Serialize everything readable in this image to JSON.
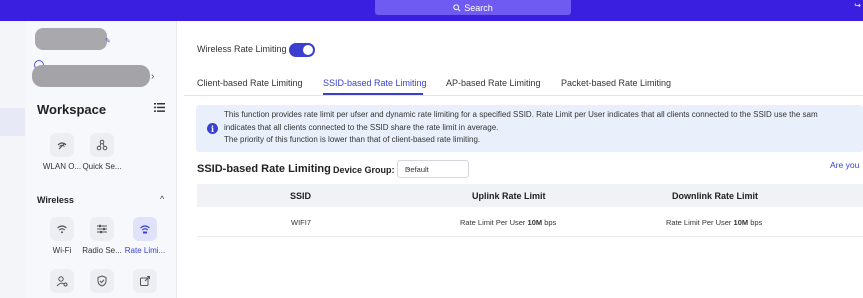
{
  "topbar": {
    "search_label": "Search"
  },
  "sidebar": {
    "workspace_title": "Workspace",
    "workspace_tiles": [
      {
        "label": "WLAN O...",
        "icon": "wlan-icon"
      },
      {
        "label": "Quick Se...",
        "icon": "quick-setup-icon"
      }
    ],
    "section_title": "Wireless",
    "wireless_tiles": [
      {
        "label": "Wi-Fi",
        "icon": "wifi-icon"
      },
      {
        "label": "Radio Se...",
        "icon": "radio-settings-icon"
      },
      {
        "label": "Rate Limi...",
        "icon": "rate-limit-icon",
        "active": true
      }
    ]
  },
  "main": {
    "toggle_label": "Wireless Rate Limiting",
    "toggle_on": true,
    "tabs": [
      {
        "label": "Client-based Rate Limiting"
      },
      {
        "label": "SSID-based Rate Limiting",
        "active": true
      },
      {
        "label": "AP-based Rate Limiting"
      },
      {
        "label": "Packet-based Rate Limiting"
      }
    ],
    "info_lines": [
      "This function provides rate limit per ufser and dynamic rate limiting for a specified SSID. Rate Limit per User indicates that all clients connected to the SSID use the sam",
      "indicates that all clients connected to the SSID share the rate limit in average.",
      "The priority of this function is lower than that of client-based rate limiting."
    ],
    "section_title": "SSID-based Rate Limiting",
    "device_group_label": "Device Group:",
    "device_group_value": "Default",
    "are_you_text": "Are you",
    "table": {
      "headers": [
        "SSID",
        "Uplink Rate Limit",
        "Downlink Rate Limit"
      ],
      "rows": [
        {
          "ssid": "WIFI7",
          "uplink_prefix": "Rate Limit Per User ",
          "uplink_value": "10M",
          "uplink_suffix": " bps",
          "downlink_prefix": "Rate Limit Per User ",
          "downlink_value": "10M",
          "downlink_suffix": " bps"
        }
      ]
    }
  },
  "colors": {
    "accent": "#3b3fd0",
    "topbar": "#3b1fe0",
    "info_bg": "#e9f0fb"
  }
}
